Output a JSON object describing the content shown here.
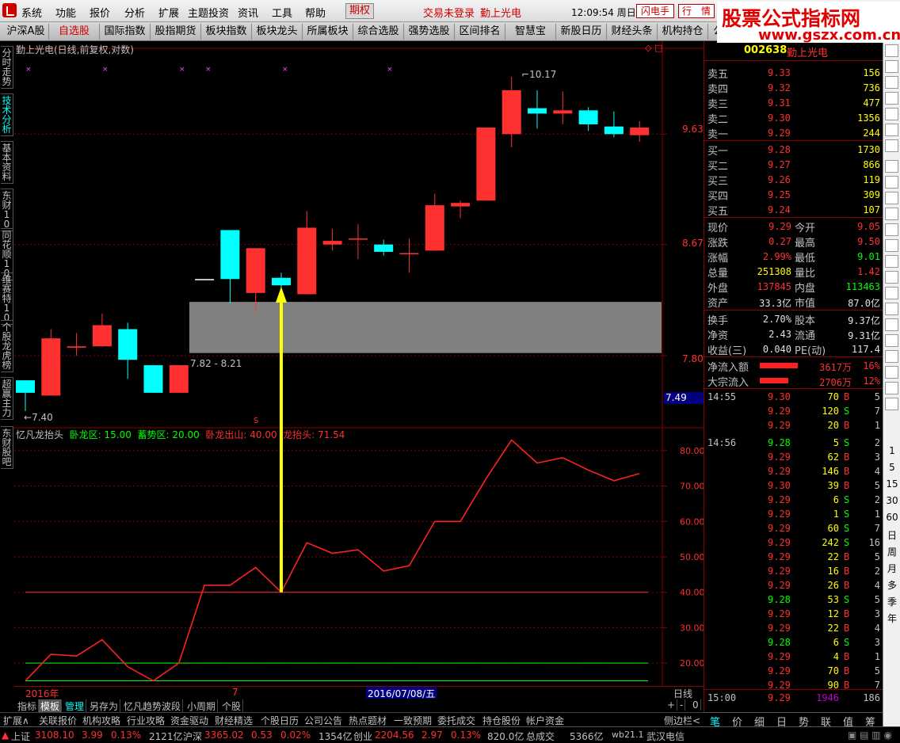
{
  "menubar": {
    "items": [
      "系统",
      "功能",
      "报价",
      "分析",
      "扩展",
      "主题投资",
      "资讯",
      "工具",
      "帮助"
    ],
    "quanshi": "期权",
    "login_status": "交易未登录",
    "stock_name": "勤上光电",
    "clock": "12:09:54",
    "weekday": "周日",
    "flash_btn": "闪电手",
    "quote_btn": "行　情"
  },
  "watermark": {
    "title": "股票公式指标网",
    "url": "www.gszx.com.cn"
  },
  "tabs": [
    "沪深A股",
    "自选股",
    "国际指数",
    "股指期货",
    "板块指数",
    "板块龙头",
    "所属板块",
    "综合选股",
    "强势选股",
    "区间排名",
    "智慧宝",
    "新股日历",
    "财经头条",
    "机构持仓",
    "公司"
  ],
  "left_tabs": [
    "分时走势",
    "技术分析",
    "基本资料",
    "东财10",
    "同花顺10",
    "维赛特10",
    "个股龙虎榜",
    "超赢主力",
    "东财股吧"
  ],
  "chart": {
    "header": "勤上光电(日线,前复权,对数)",
    "price_labels": [
      "9.63",
      "8.67",
      "7.80"
    ],
    "current_price_tag": "7.49",
    "high_label": "10.17",
    "low_label": "7.40",
    "zone_label": "7.82 - 8.21",
    "marker_s": "S"
  },
  "chart_data": [
    {
      "type": "candlestick",
      "title": "勤上光电(日线,前复权,对数)",
      "candles": [
        {
          "o": 7.62,
          "c": 7.53,
          "h": 7.62,
          "l": 7.4,
          "color": "cyan"
        },
        {
          "o": 7.51,
          "c": 7.93,
          "h": 8.0,
          "l": 7.51,
          "color": "red"
        },
        {
          "o": 7.86,
          "c": 7.87,
          "h": 7.97,
          "l": 7.8,
          "color": "red"
        },
        {
          "o": 7.87,
          "c": 8.03,
          "h": 8.12,
          "l": 7.87,
          "color": "red"
        },
        {
          "o": 8.0,
          "c": 7.77,
          "h": 8.05,
          "l": 7.63,
          "color": "cyan"
        },
        {
          "o": 7.73,
          "c": 7.53,
          "h": 7.73,
          "l": 7.53,
          "color": "cyan"
        },
        {
          "o": 7.53,
          "c": 7.73,
          "h": 7.73,
          "l": 7.53,
          "color": "red"
        },
        {
          "o": 8.39,
          "c": 8.39,
          "h": 8.39,
          "l": 8.39,
          "color": "white"
        },
        {
          "o": 8.79,
          "c": 8.39,
          "h": 8.79,
          "l": 8.2,
          "color": "cyan"
        },
        {
          "o": 8.64,
          "c": 8.28,
          "h": 8.64,
          "l": 8.14,
          "color": "red"
        },
        {
          "o": 8.4,
          "c": 8.34,
          "h": 8.44,
          "l": 8.22,
          "color": "cyan"
        },
        {
          "o": 8.27,
          "c": 8.81,
          "h": 8.95,
          "l": 8.27,
          "color": "red"
        },
        {
          "o": 8.67,
          "c": 8.7,
          "h": 8.8,
          "l": 8.62,
          "color": "red"
        },
        {
          "o": 8.71,
          "c": 8.72,
          "h": 8.84,
          "l": 8.55,
          "color": "red"
        },
        {
          "o": 8.67,
          "c": 8.61,
          "h": 8.71,
          "l": 8.58,
          "color": "cyan"
        },
        {
          "o": 8.59,
          "c": 8.6,
          "h": 8.72,
          "l": 8.44,
          "color": "red"
        },
        {
          "o": 8.62,
          "c": 9.0,
          "h": 9.1,
          "l": 8.62,
          "color": "red"
        },
        {
          "o": 8.99,
          "c": 9.02,
          "h": 9.04,
          "l": 8.89,
          "color": "red"
        },
        {
          "o": 9.04,
          "c": 9.69,
          "h": 9.69,
          "l": 9.04,
          "color": "red"
        },
        {
          "o": 9.63,
          "c": 10.04,
          "h": 10.17,
          "l": 9.51,
          "color": "red"
        },
        {
          "o": 9.87,
          "c": 9.82,
          "h": 10.04,
          "l": 9.68,
          "color": "cyan"
        },
        {
          "o": 9.85,
          "c": 9.82,
          "h": 10.03,
          "l": 9.72,
          "color": "red"
        },
        {
          "o": 9.85,
          "c": 9.72,
          "h": 9.88,
          "l": 9.66,
          "color": "cyan"
        },
        {
          "o": 9.7,
          "c": 9.63,
          "h": 9.84,
          "l": 9.6,
          "color": "cyan"
        },
        {
          "o": 9.62,
          "c": 9.69,
          "h": 9.75,
          "l": 9.56,
          "color": "red"
        }
      ],
      "zone": {
        "low": 7.82,
        "high": 8.21
      },
      "ylim": [
        7.35,
        10.3
      ]
    },
    {
      "type": "line",
      "title": "忆凡龙抬头",
      "legend": [
        {
          "label": "卧龙区: 15.00",
          "color": "#00ff00"
        },
        {
          "label": "蓄势区: 20.00",
          "color": "#00ff00"
        },
        {
          "label": "卧龙出山: 40.00",
          "color": "#ff3030"
        },
        {
          "label": "龙抬头: 71.54",
          "color": "#ff3030"
        }
      ],
      "yticks": [
        "80.00",
        "70.00",
        "60.00",
        "50.00",
        "40.00",
        "30.00",
        "20.00"
      ],
      "hlines": [
        15,
        20,
        40
      ],
      "values": [
        15.0,
        22.5,
        22.0,
        26.6,
        19.0,
        15.0,
        20.0,
        42.0,
        42.0,
        47.0,
        40.0,
        54.0,
        51.0,
        52.0,
        46.0,
        47.5,
        60.0,
        60.0,
        72.0,
        83.0,
        76.5,
        78.0,
        74.5,
        71.5,
        73.5
      ],
      "ylim": [
        14,
        86
      ]
    }
  ],
  "indicator": {
    "name": "忆凡龙抬头",
    "legend": [
      {
        "label": "卧龙区: 15.00",
        "color": "#00ff00"
      },
      {
        "label": "蓄势区: 20.00",
        "color": "#00ff00"
      },
      {
        "label": "卧龙出山: 40.00",
        "color": "#ff3030"
      },
      {
        "label": "龙抬头: 71.54",
        "color": "#ff3030"
      }
    ]
  },
  "datebar": {
    "year_label": "2016年",
    "month_label": "7",
    "cursor_date": "2016/07/08/五",
    "period": "日线"
  },
  "indicator_tabs": [
    "指标",
    "模板",
    "管理",
    "另存为",
    "忆凡趋势波段",
    "小周期",
    "个股"
  ],
  "zoom_controls": [
    "+",
    "-",
    "0"
  ],
  "func_bar": [
    "扩展∧",
    "关联报价",
    "机构攻略",
    "行业攻略",
    "资金驱动",
    "财经精选",
    "个股日历",
    "公司公告",
    "热点题材",
    "一致预期",
    "委托成交",
    "持仓股份",
    "帐户资金",
    "侧边栏<"
  ],
  "right_panel": {
    "code": "002638",
    "name": "勤上光电",
    "asks": [
      {
        "label": "卖五",
        "price": "9.33",
        "vol": "156"
      },
      {
        "label": "卖四",
        "price": "9.32",
        "vol": "736"
      },
      {
        "label": "卖三",
        "price": "9.31",
        "vol": "477"
      },
      {
        "label": "卖二",
        "price": "9.30",
        "vol": "1356"
      },
      {
        "label": "卖一",
        "price": "9.29",
        "vol": "244"
      }
    ],
    "bids": [
      {
        "label": "买一",
        "price": "9.28",
        "vol": "1730"
      },
      {
        "label": "买二",
        "price": "9.27",
        "vol": "866"
      },
      {
        "label": "买三",
        "price": "9.26",
        "vol": "119"
      },
      {
        "label": "买四",
        "price": "9.25",
        "vol": "309"
      },
      {
        "label": "买五",
        "price": "9.24",
        "vol": "107"
      }
    ],
    "stats": [
      {
        "l1": "现价",
        "v1": "9.29",
        "c1": "#ff3030",
        "l2": "今开",
        "v2": "9.05",
        "c2": "#ff3030"
      },
      {
        "l1": "涨跌",
        "v1": "0.27",
        "c1": "#ff3030",
        "l2": "最高",
        "v2": "9.50",
        "c2": "#ff3030"
      },
      {
        "l1": "涨幅",
        "v1": "2.99%",
        "c1": "#ff3030",
        "l2": "最低",
        "v2": "9.01",
        "c2": "#00ff00"
      },
      {
        "l1": "总量",
        "v1": "251308",
        "c1": "#ffff00",
        "l2": "量比",
        "v2": "1.42",
        "c2": "#ff3030"
      },
      {
        "l1": "外盘",
        "v1": "137845",
        "c1": "#ff3030",
        "l2": "内盘",
        "v2": "113463",
        "c2": "#00ff00"
      },
      {
        "l1": "资产",
        "v1": "33.3亿",
        "c1": "#e0e0e0",
        "l2": "市值",
        "v2": "87.0亿",
        "c2": "#e0e0e0"
      }
    ],
    "stats2": [
      {
        "l1": "换手",
        "v1": "2.70%",
        "l2": "股本",
        "v2": "9.37亿"
      },
      {
        "l1": "净资",
        "v1": "2.43",
        "l2": "流通",
        "v2": "9.31亿"
      },
      {
        "l1": "收益(三)",
        "v1": "0.040",
        "l2": "PE(动)",
        "v2": "117.4"
      }
    ],
    "flows": [
      {
        "label": "净流入额",
        "value": "3617万",
        "pct": "16%",
        "bar_fraction": 0.16
      },
      {
        "label": "大宗流入",
        "value": "2706万",
        "pct": "12%",
        "bar_fraction": 0.12
      }
    ],
    "ticks": [
      {
        "time": "14:55",
        "price": "9.30",
        "vol": "70",
        "side": "B",
        "n": "5"
      },
      {
        "time": "",
        "price": "9.29",
        "vol": "120",
        "side": "S",
        "n": "7"
      },
      {
        "time": "",
        "price": "9.29",
        "vol": "20",
        "side": "B",
        "n": "1"
      },
      {
        "time": "14:56",
        "price": "9.28",
        "vol": "5",
        "side": "S",
        "n": "2"
      },
      {
        "time": "",
        "price": "9.29",
        "vol": "62",
        "side": "B",
        "n": "3"
      },
      {
        "time": "",
        "price": "9.29",
        "vol": "146",
        "side": "B",
        "n": "4"
      },
      {
        "time": "",
        "price": "9.30",
        "vol": "39",
        "side": "B",
        "n": "5"
      },
      {
        "time": "",
        "price": "9.29",
        "vol": "6",
        "side": "S",
        "n": "2"
      },
      {
        "time": "",
        "price": "9.29",
        "vol": "1",
        "side": "S",
        "n": "1"
      },
      {
        "time": "",
        "price": "9.29",
        "vol": "60",
        "side": "S",
        "n": "7"
      },
      {
        "time": "",
        "price": "9.29",
        "vol": "242",
        "side": "S",
        "n": "16"
      },
      {
        "time": "",
        "price": "9.29",
        "vol": "22",
        "side": "B",
        "n": "5"
      },
      {
        "time": "",
        "price": "9.29",
        "vol": "16",
        "side": "B",
        "n": "2"
      },
      {
        "time": "",
        "price": "9.29",
        "vol": "26",
        "side": "B",
        "n": "4"
      },
      {
        "time": "",
        "price": "9.28",
        "vol": "53",
        "side": "S",
        "n": "5"
      },
      {
        "time": "",
        "price": "9.29",
        "vol": "12",
        "side": "B",
        "n": "3"
      },
      {
        "time": "",
        "price": "9.29",
        "vol": "22",
        "side": "B",
        "n": "4"
      },
      {
        "time": "",
        "price": "9.28",
        "vol": "6",
        "side": "S",
        "n": "3"
      },
      {
        "time": "",
        "price": "9.29",
        "vol": "4",
        "side": "B",
        "n": "1"
      },
      {
        "time": "",
        "price": "9.29",
        "vol": "70",
        "side": "B",
        "n": "5"
      },
      {
        "time": "",
        "price": "9.29",
        "vol": "90",
        "side": "B",
        "n": "7"
      }
    ],
    "close_tick": {
      "time": "15:00",
      "price": "9.29",
      "vol": "1946",
      "n": "186"
    },
    "bottom_tabs": [
      "笔",
      "价",
      "细",
      "日",
      "势",
      "联",
      "值",
      "筹"
    ]
  },
  "right_tools": {
    "periods": [
      "1",
      "5",
      "15",
      "30",
      "60",
      "日",
      "周",
      "月",
      "多",
      "季",
      "年"
    ]
  },
  "statusbar": {
    "sh_label": "上证",
    "sh_index": "3108.10",
    "sh_change": "3.99",
    "sh_pct": "0.13%",
    "sh_amount": "2121亿",
    "hs_label": "沪深",
    "hs_index": "3365.02",
    "hs_change": "0.53",
    "hs_pct": "0.02%",
    "hs_amount": "1354亿",
    "cy_label": "创业",
    "cy_index": "2204.56",
    "cy_change": "2.97",
    "cy_pct": "0.13%",
    "cy_amount": "820.0亿",
    "total_label": "总成交",
    "total_amount": "5366亿",
    "version": "wb21.1",
    "server": "武汉电信"
  },
  "colors": {
    "up": "#ff3030",
    "down": "#00ffff",
    "grid": "#8b0000",
    "zone": "#808080",
    "arrow": "#ffff00"
  }
}
